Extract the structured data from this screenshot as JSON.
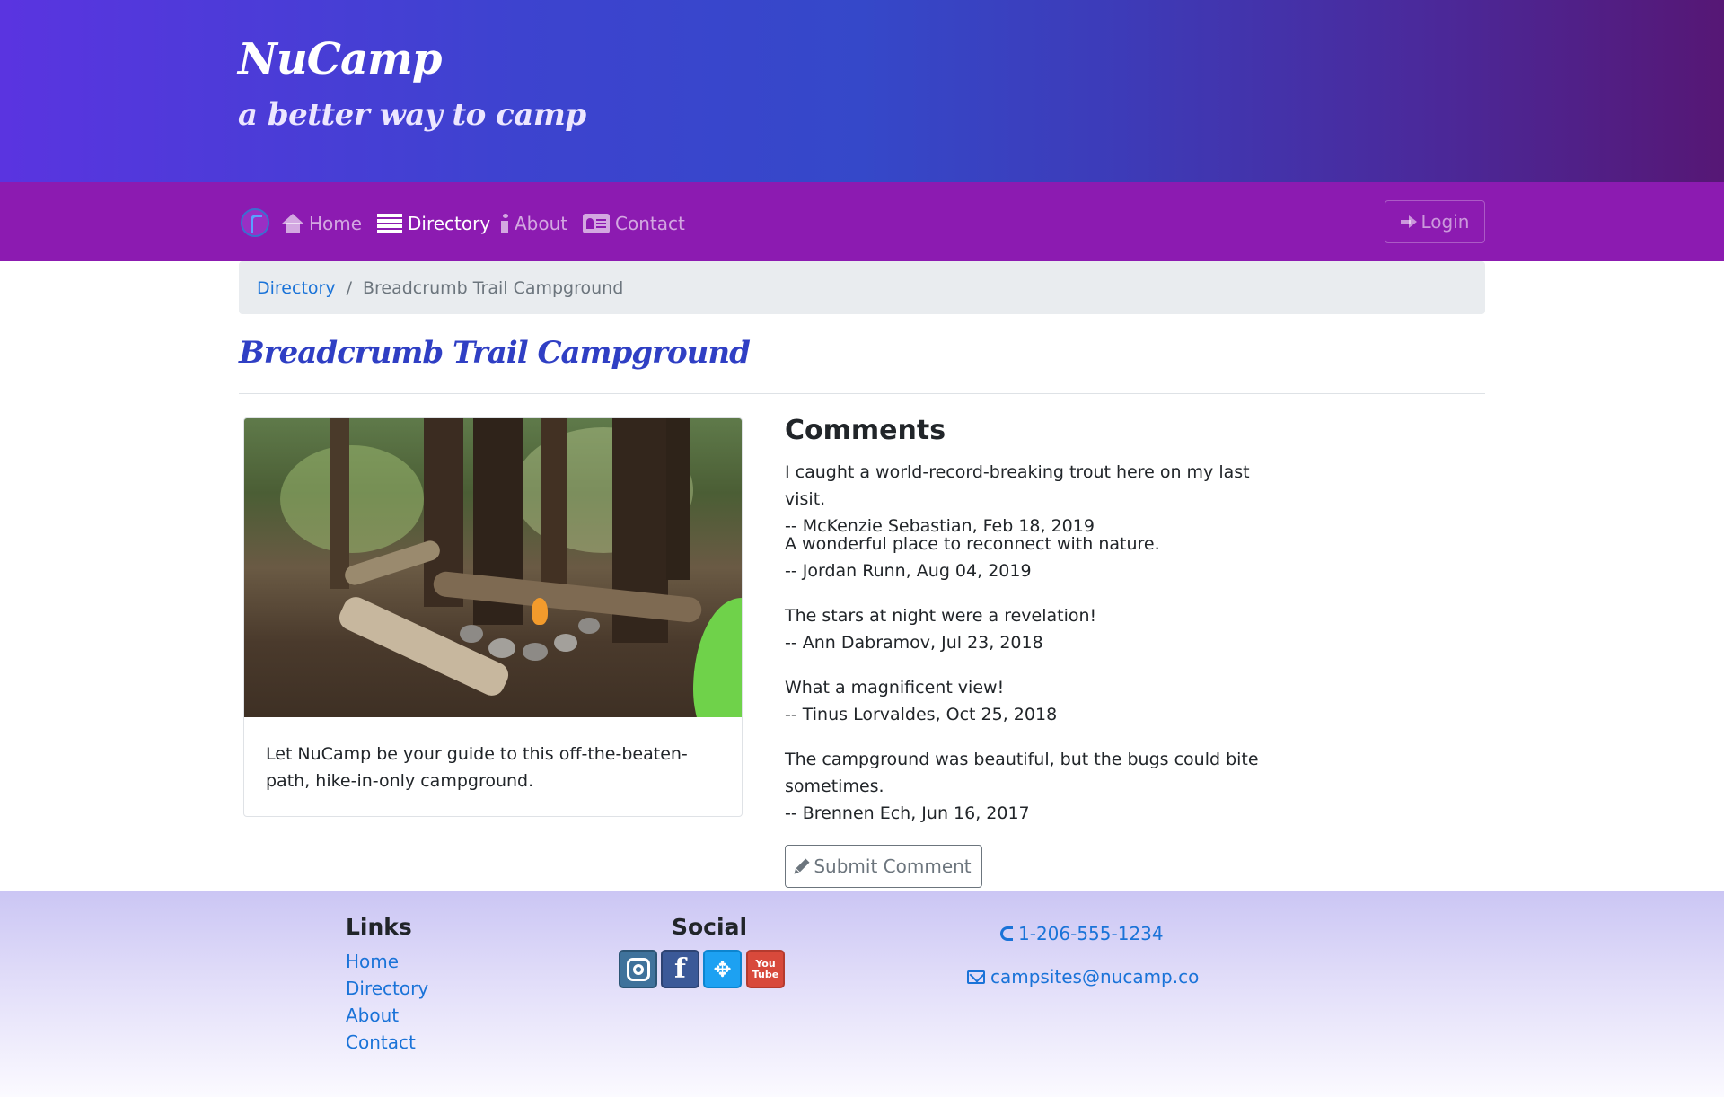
{
  "header": {
    "brand": "NuCamp",
    "tagline": "a better way to camp"
  },
  "nav": {
    "items": [
      {
        "label": "Home",
        "icon": "home-icon",
        "active": false
      },
      {
        "label": "Directory",
        "icon": "list-icon",
        "active": true
      },
      {
        "label": "About",
        "icon": "info-icon",
        "active": false
      },
      {
        "label": "Contact",
        "icon": "address-card-icon",
        "active": false
      }
    ],
    "login_label": "Login"
  },
  "breadcrumb": {
    "link": "Directory",
    "current": "Breadcrumb Trail Campground"
  },
  "campsite": {
    "name": "Breadcrumb Trail Campground",
    "description": "Let NuCamp be your guide to this off-the-beaten-path, hike-in-only campground."
  },
  "comments": {
    "heading": "Comments",
    "items": [
      {
        "text": "I caught a world-record-breaking trout here on my last visit.",
        "byline": "-- McKenzie Sebastian, Feb 18, 2019"
      },
      {
        "text": "A wonderful place to reconnect with nature.",
        "byline": "-- Jordan Runn, Aug 04, 2019"
      },
      {
        "text": "The stars at night were a revelation!",
        "byline": "-- Ann Dabramov, Jul 23, 2018"
      },
      {
        "text": "What a magnificent view!",
        "byline": "-- Tinus Lorvaldes, Oct 25, 2018"
      },
      {
        "text": "The campground was beautiful, but the bugs could bite sometimes.",
        "byline": "-- Brennen Ech, Jun 16, 2017"
      }
    ],
    "submit_label": "Submit Comment"
  },
  "footer": {
    "links_heading": "Links",
    "links": [
      "Home",
      "Directory",
      "About",
      "Contact"
    ],
    "social_heading": "Social",
    "social": [
      "instagram-icon",
      "facebook-icon",
      "twitter-icon",
      "youtube-icon"
    ],
    "phone": "1-206-555-1234",
    "email": "campsites@nucamp.co"
  },
  "colors": {
    "navbar": "#8c1bb1",
    "title": "#2f3fc4",
    "link": "#1a73d8"
  }
}
